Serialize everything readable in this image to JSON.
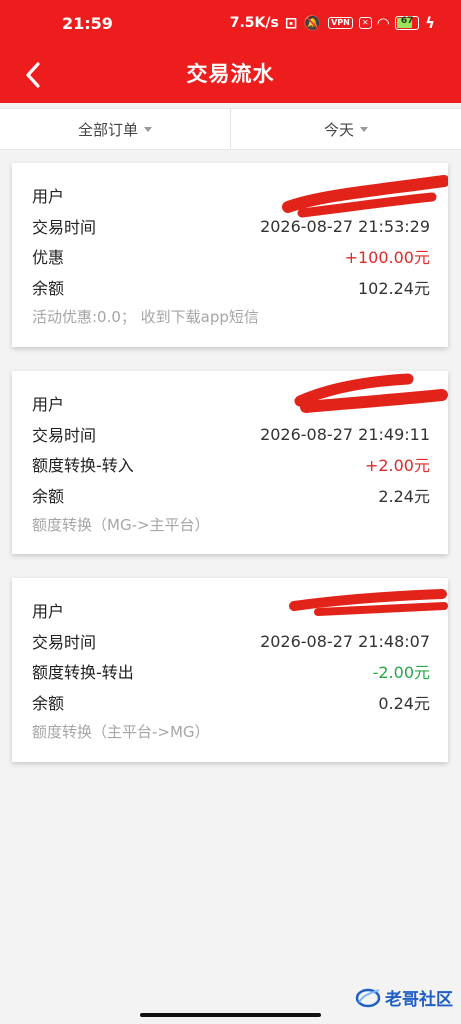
{
  "status_bar": {
    "time": "21:59",
    "network_speed": "7.5K/s",
    "vpn_label": "VPN",
    "battery": "67"
  },
  "header": {
    "title": "交易流水"
  },
  "filters": {
    "order_type": "全部订单",
    "date_range": "今天"
  },
  "transactions": [
    {
      "user_label": "用户",
      "time_label": "交易时间",
      "time_value": "2026-08-27 21:53:29",
      "type_label": "优惠",
      "amount": "+100.00元",
      "balance_label": "余额",
      "balance": "102.24元",
      "note": "活动优惠:0.0；  收到下载app短信"
    },
    {
      "user_label": "用户",
      "time_label": "交易时间",
      "time_value": "2026-08-27 21:49:11",
      "type_label": "额度转换-转入",
      "amount": "+2.00元",
      "balance_label": "余额",
      "balance": "2.24元",
      "note": "额度转换（MG->主平台）"
    },
    {
      "user_label": "用户",
      "time_label": "交易时间",
      "time_value": "2026-08-27 21:48:07",
      "type_label": "额度转换-转出",
      "amount": "-2.00元",
      "balance_label": "余额",
      "balance": "0.24元",
      "note": "额度转换（主平台->MG）"
    }
  ],
  "colors": {
    "brand_red": "#ee1d1d",
    "amount_positive": "#e02a2a",
    "amount_negative": "#27a845"
  },
  "watermark": {
    "text": "老哥社区"
  }
}
